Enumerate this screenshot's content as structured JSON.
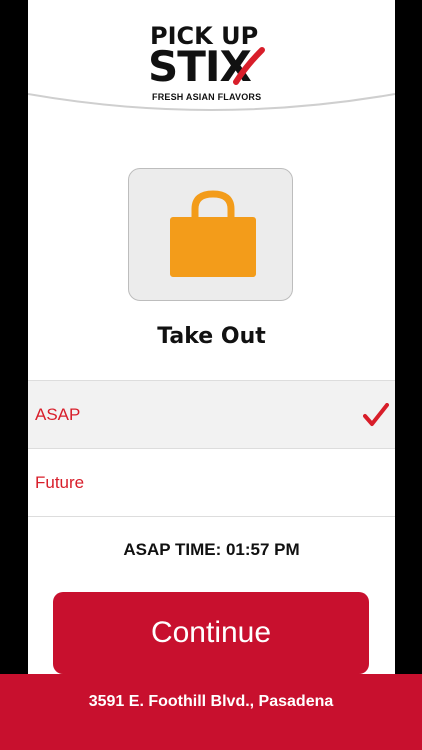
{
  "brand": {
    "line1": "PICK UP",
    "line2": "STIX",
    "tagline": "FRESH ASIAN FLAVORS",
    "accent_color": "#c8102e"
  },
  "order_mode": {
    "icon": "shopping-bag-icon",
    "icon_color": "#f39c1a",
    "title": "Take Out"
  },
  "time_options": [
    {
      "label": "ASAP",
      "selected": true,
      "indicator_icon": "checkmark-icon"
    },
    {
      "label": "Future",
      "selected": false
    }
  ],
  "asap_time": "ASAP TIME: 01:57 PM",
  "continue_label": "Continue",
  "footer": {
    "address": "3591 E. Foothill Blvd., Pasadena"
  }
}
